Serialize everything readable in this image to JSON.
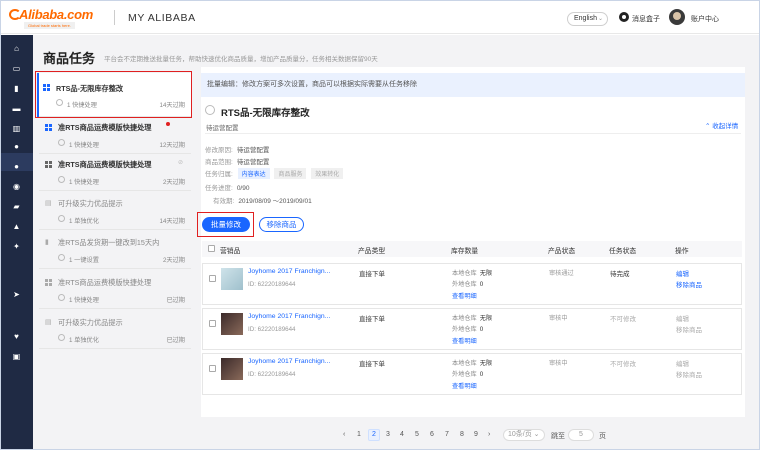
{
  "header": {
    "logo_text": "Alibaba.com",
    "logo_tagline": "Global trade starts here.",
    "title": "MY ALIBABA",
    "language": "English",
    "messages_label": "消息盒子",
    "account_label": "账户中心"
  },
  "page": {
    "title": "商品任务",
    "description": "平台会不定期推送批量任务，帮助快速优化商品质量，增加产品质量分，任务相关数据保留90天"
  },
  "task_list": [
    {
      "title": "RTS品-无限库存整改",
      "count": "1 快捷处理",
      "status": "14天过期",
      "icon": "grid-icon",
      "selected": true
    },
    {
      "title": "准RTS商品运费模版快捷处理",
      "count": "1 快捷处理",
      "status": "12天过期",
      "icon": "grid-icon",
      "new": true
    },
    {
      "title": "准RTS商品运费模版快捷处理",
      "count": "1 快捷处理",
      "status": "2天过期",
      "icon": "grid-icon"
    },
    {
      "title": "可升级实力优品提示",
      "count": "1 单独优化",
      "status": "14天过期",
      "icon": "doc-icon",
      "dim": true
    },
    {
      "title": "准RTS品发货期一键改到15天内",
      "count": "1 一键设置",
      "status": "2天过期",
      "icon": "bookmark-icon",
      "dim": true
    },
    {
      "title": "准RTS商品运费模版快捷处理",
      "count": "1 快捷处理",
      "status": "已过期",
      "icon": "grid-icon",
      "dim": true
    },
    {
      "title": "可升级实力优品提示",
      "count": "1 单独优化",
      "status": "已过期",
      "icon": "doc-icon",
      "dim": true
    }
  ],
  "detail": {
    "banner": "批量编辑：修改方案可多次设置，商品可以根据实际需要从任务移除",
    "title": "RTS品-无限库存整改",
    "subtitle": "待运营配置",
    "collapse_label": "收起详情",
    "reason_label": "修改原因:",
    "reason_value": "待运营配置",
    "scope_label": "商品范围:",
    "scope_value": "待运营配置",
    "impact_label": "任务归属:",
    "impact_tags": [
      "内容表达",
      "商品服务",
      "效果转化"
    ],
    "progress_label": "任务进度:",
    "progress_value": "0/90",
    "period_label": "有效期:",
    "period_value": "2019/08/09 ～2019/09/01"
  },
  "actions": {
    "batch_edit": "批量修改",
    "remove": "移除商品"
  },
  "table": {
    "headers": [
      "营销品",
      "产品类型",
      "库存数量",
      "产品状态",
      "任务状态",
      "操作"
    ],
    "rows": [
      {
        "name": "Joyhome 2017 Franchign...",
        "id": "ID: 62220189644",
        "type": "直接下单",
        "stock_local_label": "本地仓库",
        "stock_local": "无限",
        "stock_overseas_label": "外地仓库",
        "stock_overseas": "0",
        "view": "查看明细",
        "product_status": "审核通过",
        "task_status": "待完成",
        "op1": "编辑",
        "op2": "移除商品",
        "thumb": "light"
      },
      {
        "name": "Joyhome 2017 Franchign...",
        "id": "ID: 62220189644",
        "type": "直接下单",
        "stock_local_label": "本地仓库",
        "stock_local": "无限",
        "stock_overseas_label": "外地仓库",
        "stock_overseas": "0",
        "view": "查看明细",
        "product_status": "审核中",
        "task_status": "不可修改",
        "op1": "编辑",
        "op2": "移除商品",
        "thumb": "dark"
      },
      {
        "name": "Joyhome 2017 Franchign...",
        "id": "ID: 62220189644",
        "type": "直接下单",
        "stock_local_label": "本地仓库",
        "stock_local": "无限",
        "stock_overseas_label": "外地仓库",
        "stock_overseas": "0",
        "view": "查看明细",
        "product_status": "审核中",
        "task_status": "不可修改",
        "op1": "编辑",
        "op2": "移除商品",
        "thumb": "dark"
      }
    ]
  },
  "pagination": {
    "prev": "‹",
    "pages": [
      "1",
      "2",
      "3",
      "4",
      "5",
      "6",
      "7",
      "8",
      "9"
    ],
    "current": "2",
    "next": "›",
    "page_size": "10条/页",
    "jump_label": "跳至",
    "jump_value": "5",
    "page_unit": "页"
  },
  "colors": {
    "accent": "#1a66ff",
    "nav_bg": "#1f2a44",
    "brand": "#ff6a00",
    "highlight": "#e02020"
  }
}
